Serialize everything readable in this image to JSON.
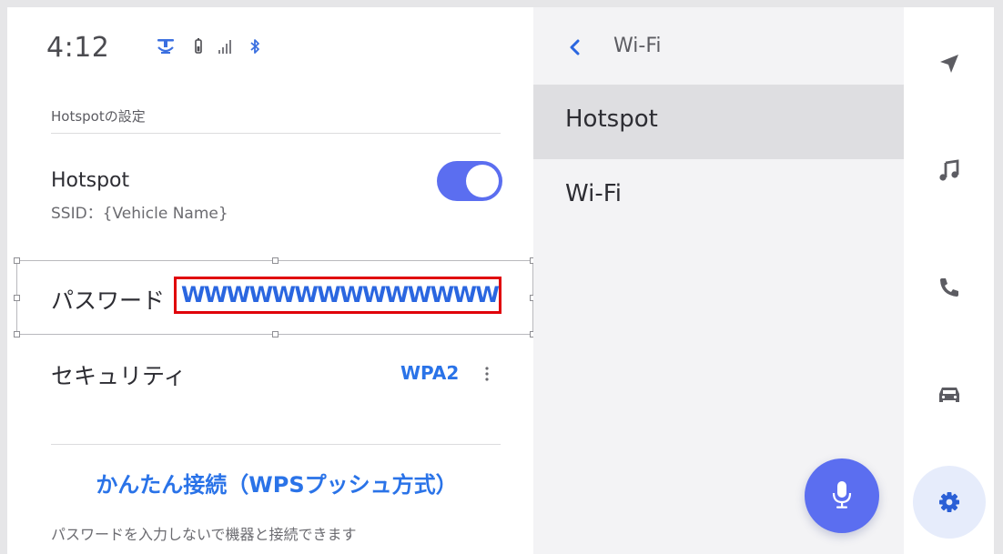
{
  "status_bar": {
    "time": "4:12",
    "icons": [
      "connectivity-icon",
      "battery-icon",
      "signal-icon",
      "bluetooth-icon"
    ]
  },
  "hotspot_settings": {
    "section_label": "Hotspotの設定",
    "hotspot": {
      "title": "Hotspot",
      "ssid": "SSID：{Vehicle Name}",
      "enabled": true
    },
    "password": {
      "label": "パスワード",
      "value": "WWWWWWWWWWWWWWW"
    },
    "security": {
      "label": "セキュリティ",
      "value": "WPA2"
    },
    "wps": {
      "button_label": "かんたん接続（WPSプッシュ方式）",
      "note": "パスワードを入力しないで機器と接続できます"
    }
  },
  "menu": {
    "back_label": "Wi-Fi",
    "items": [
      {
        "label": "Hotspot",
        "selected": true
      },
      {
        "label": "Wi-Fi",
        "selected": false
      }
    ]
  },
  "nav_rail": {
    "items": [
      {
        "icon": "navigation-icon",
        "active": false
      },
      {
        "icon": "music-icon",
        "active": false
      },
      {
        "icon": "phone-icon",
        "active": false
      },
      {
        "icon": "car-icon",
        "active": false
      },
      {
        "icon": "settings-icon",
        "active": true
      }
    ]
  },
  "colors": {
    "accent": "#5b6ef0",
    "link": "#2a73e8",
    "highlight_border": "#e0000a",
    "selected_menu": "#dedee1"
  }
}
